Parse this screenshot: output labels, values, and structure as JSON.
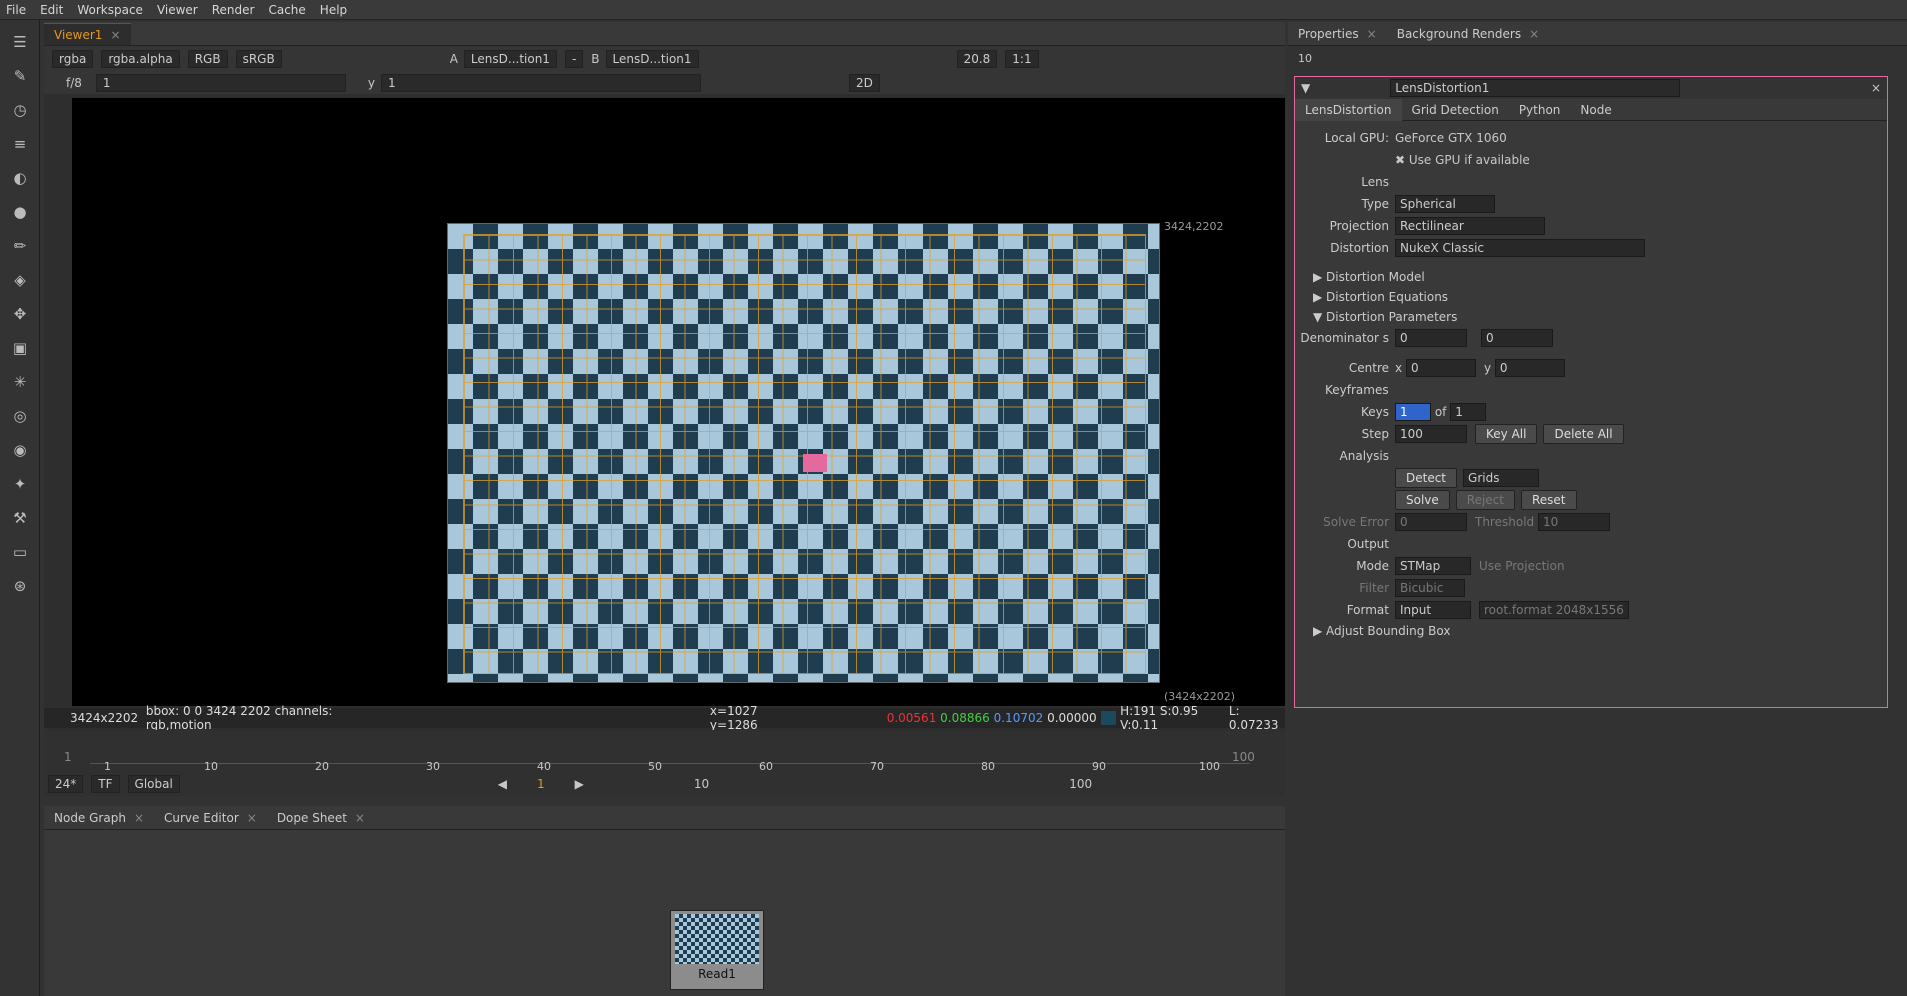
{
  "menu": [
    "File",
    "Edit",
    "Workspace",
    "Viewer",
    "Render",
    "Cache",
    "Help"
  ],
  "viewer": {
    "tab": "Viewer1",
    "channels": "rgba",
    "alpha": "rgba.alpha",
    "colorspace": "RGB",
    "lut": "sRGB",
    "input_a": "LensD...tion1",
    "input_b": "LensD...tion1",
    "dash": "-",
    "fstop": "f/8",
    "frame": "1",
    "y": "1",
    "zoom": "20.8",
    "ratio": "1:1",
    "mode": "2D",
    "corner_tr": "3424,2202",
    "corner_br": "(3424x2202)"
  },
  "info": {
    "format": "3424x2202",
    "bbox": "bbox: 0 0 3424 2202 channels: rgb,motion",
    "coords": "x=1027 y=1286",
    "r": "0.00561",
    "g": "0.08866",
    "b": "0.10702",
    "a": "0.00000",
    "hsv": "H:191 S:0.95 V:0.11",
    "l": "L: 0.07233"
  },
  "timeline": {
    "ticks": [
      "1",
      "10",
      "20",
      "30",
      "40",
      "50",
      "60",
      "70",
      "80",
      "90",
      "100"
    ],
    "start": "1",
    "end": "100",
    "fps": "24*",
    "tf": "TF",
    "global": "Global",
    "current": "1",
    "step": "10",
    "end2": "100"
  },
  "bottom_tabs": [
    "Node Graph",
    "Curve Editor",
    "Dope Sheet"
  ],
  "node": {
    "label": "Read1"
  },
  "props_tabs": [
    "Properties",
    "Background Renders"
  ],
  "panel": {
    "count": "10",
    "name": "LensDistortion1",
    "tabs": [
      "LensDistortion",
      "Grid Detection",
      "Python",
      "Node"
    ],
    "local_gpu_label": "Local GPU:",
    "local_gpu": "GeForce GTX 1060",
    "use_gpu": "Use GPU if available",
    "lens": "Lens",
    "type_label": "Type",
    "type": "Spherical",
    "proj_label": "Projection",
    "proj": "Rectilinear",
    "dist_label": "Distortion",
    "dist": "NukeX Classic",
    "sections": [
      "Distortion Model",
      "Distortion Equations",
      "Distortion Parameters"
    ],
    "denom_label": "Denominator s",
    "denom1": "0",
    "denom2": "0",
    "centre_label": "Centre",
    "cx_label": "x",
    "cx": "0",
    "cy_label": "y",
    "cy": "0",
    "keyframes": "Keyframes",
    "keys_label": "Keys",
    "keys": "1",
    "of": "of",
    "of_val": "1",
    "step_label": "Step",
    "step": "100",
    "key_all": "Key All",
    "delete_all": "Delete All",
    "analysis": "Analysis",
    "detect": "Detect",
    "grids": "Grids",
    "solve": "Solve",
    "reject": "Reject",
    "reset": "Reset",
    "solve_err_label": "Solve Error",
    "solve_err": "0",
    "threshold_label": "Threshold",
    "threshold": "10",
    "output": "Output",
    "mode_label": "Mode",
    "mode": "STMap",
    "use_proj": "Use Projection",
    "filter_label": "Filter",
    "filter": "Bicubic",
    "format_label": "Format",
    "format": "Input",
    "format2": "root.format 2048x1556",
    "adjust": "Adjust Bounding Box"
  }
}
